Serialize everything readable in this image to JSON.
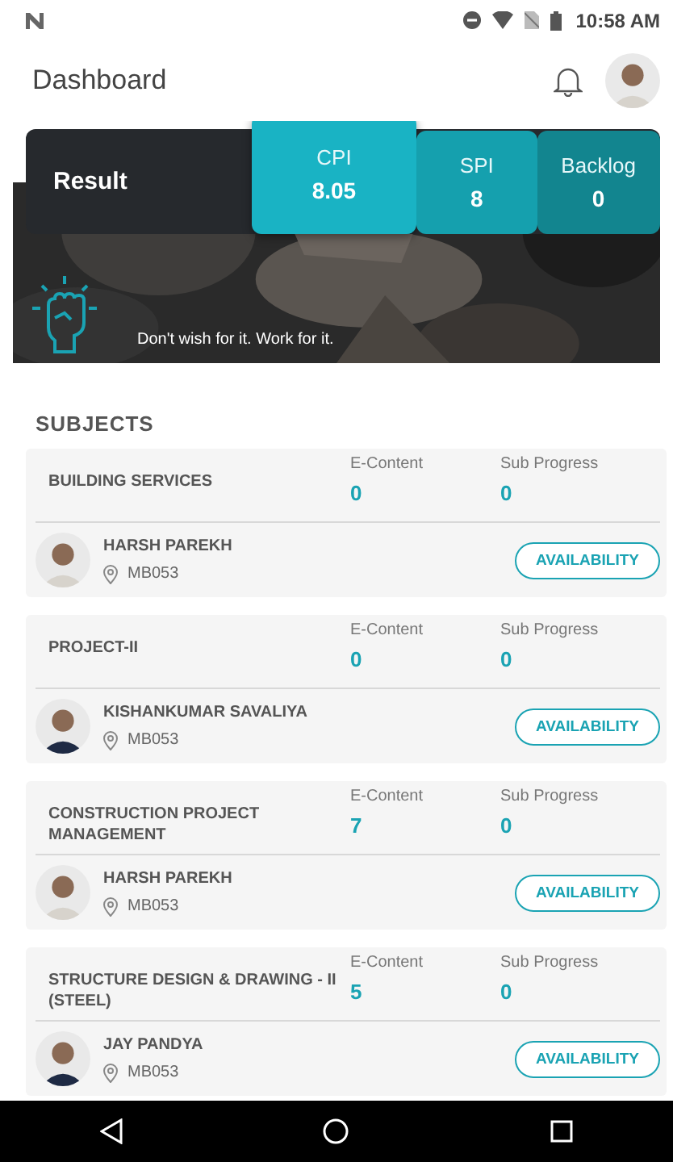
{
  "status_bar": {
    "time": "10:58 AM"
  },
  "header": {
    "title": "Dashboard"
  },
  "result": {
    "label": "Result",
    "metrics": [
      {
        "label": "CPI",
        "value": "8.05",
        "selected": true
      },
      {
        "label": "SPI",
        "value": "8",
        "selected": false
      },
      {
        "label": "Backlog",
        "value": "0",
        "selected": false
      }
    ]
  },
  "banner": {
    "quote": "Don't wish for it. Work for it."
  },
  "subjects": {
    "heading": "SUBJECTS",
    "items": [
      {
        "title": "BUILDING SERVICES",
        "e_content_label": "E-Content",
        "e_content": "0",
        "sub_progress_label": "Sub Progress",
        "sub_progress": "0",
        "faculty": "HARSH PAREKH",
        "room": "MB053",
        "action": "AVAILABILITY"
      },
      {
        "title": "PROJECT-II",
        "e_content_label": "E-Content",
        "e_content": "0",
        "sub_progress_label": "Sub Progress",
        "sub_progress": "0",
        "faculty": "KISHANKUMAR SAVALIYA",
        "room": "MB053",
        "action": "AVAILABILITY"
      },
      {
        "title": "CONSTRUCTION PROJECT MANAGEMENT",
        "e_content_label": "E-Content",
        "e_content": "7",
        "sub_progress_label": "Sub Progress",
        "sub_progress": "0",
        "faculty": "HARSH PAREKH",
        "room": "MB053",
        "action": "AVAILABILITY"
      },
      {
        "title": "STRUCTURE DESIGN & DRAWING - II (STEEL)",
        "e_content_label": "E-Content",
        "e_content": "5",
        "sub_progress_label": "Sub Progress",
        "sub_progress": "0",
        "faculty": "JAY PANDYA",
        "room": "MB053",
        "action": "AVAILABILITY"
      }
    ]
  }
}
